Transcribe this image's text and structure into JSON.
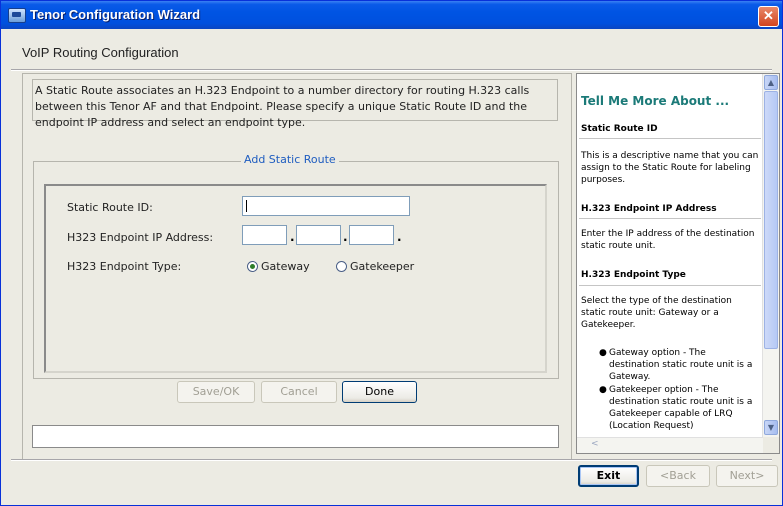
{
  "window": {
    "title": "Tenor Configuration Wizard",
    "close_glyph": "✕"
  },
  "page": {
    "heading": "VoIP Routing Configuration",
    "description": "A Static Route associates an H.323 Endpoint to a number directory for routing H.323 calls between this Tenor AF and that Endpoint. Please specify a unique Static Route ID and the endpoint IP address and select an endpoint type."
  },
  "form": {
    "group_title": "Add Static Route",
    "route_id_label": "Static Route ID:",
    "route_id_value": "",
    "ip_label": "H323 Endpoint IP Address:",
    "ip_octets": [
      "",
      "",
      "",
      ""
    ],
    "ip_separator": ".",
    "type_label": "H323 Endpoint Type:",
    "type_options": [
      {
        "label": "Gateway",
        "selected": true
      },
      {
        "label": "Gatekeeper",
        "selected": false
      }
    ]
  },
  "form_buttons": {
    "save_ok": "Save/OK",
    "cancel": "Cancel",
    "done": "Done"
  },
  "status_field": "",
  "help": {
    "title": "Tell Me More About ...",
    "sections": [
      {
        "heading": "Static Route ID",
        "text": "This is a descriptive name that you can assign to the Static Route for labeling purposes."
      },
      {
        "heading": "H.323 Endpoint IP Address",
        "text": "Enter the IP address of the destination static route unit."
      },
      {
        "heading": "H.323 Endpoint Type",
        "text": "Select the type of the destination static route unit: Gateway or a Gatekeeper."
      }
    ],
    "bullets": [
      "Gateway option - The destination static route unit is a Gateway.",
      "Gatekeeper option - The destination static route unit is a Gatekeeper capable of LRQ (Location Request)"
    ],
    "scroll_up": "▲",
    "scroll_down": "▼",
    "scroll_left": "<"
  },
  "nav": {
    "exit": "Exit",
    "back": "<Back",
    "next": "Next>"
  },
  "icons": {
    "bullet": "●"
  }
}
